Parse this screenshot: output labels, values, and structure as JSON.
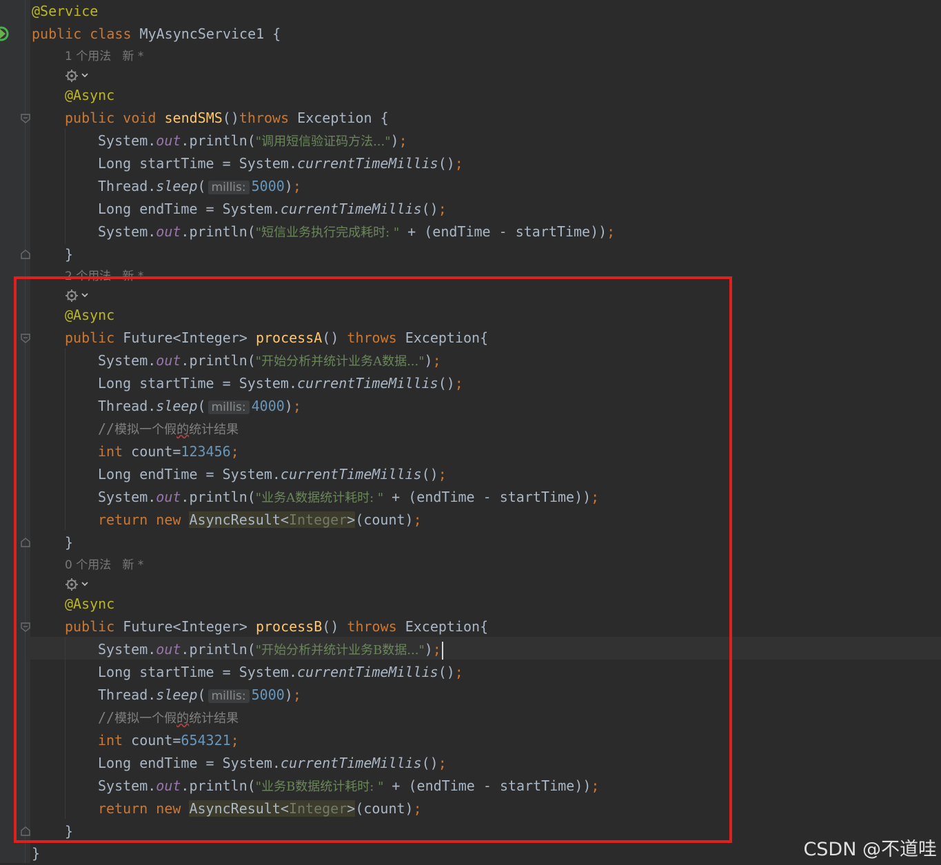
{
  "usage_hints": {
    "first": "1 个用法   新 *",
    "second": "2 个用法   新 *",
    "third": "0 个用法   新 *"
  },
  "icons": {
    "run_gutter": "run-gutter-icon",
    "inspect": "gear-chevron-icon",
    "fold": "fold-marker-icon"
  },
  "colors": {
    "background": "#2b2b2b",
    "keyword": "#cc7832",
    "annotation": "#bbb529",
    "method": "#ffc66d",
    "string": "#6a8759",
    "number": "#6897bb",
    "highlight_box": "#e0201e"
  },
  "code": {
    "l01_a": "@Service",
    "l02_kw": "public class",
    "l02_b": " MyAsyncService1 {",
    "l03_a": "@Async",
    "l04_kw1": "public void",
    "l04_fn": "sendSMS",
    "l04_p": "()",
    "l04_kw2": "throws",
    "l04_b": " Exception {",
    "l05_a": "System.",
    "l05_f": "out",
    "l05_b": ".println(",
    "l05_s": "\"调用短信验证码方法...\"",
    "l05_c": ")",
    "l05_sc": ";",
    "l06_a": "Long startTime = System.",
    "l06_i": "currentTimeMillis",
    "l06_b": "()",
    "l06_sc": ";",
    "l07_a": "Thread.",
    "l07_i": "sleep",
    "l07_b": "(",
    "l07_hint": "millis:",
    "l07_n": "5000",
    "l07_c": ")",
    "l07_sc": ";",
    "l08_a": "Long endTime = System.",
    "l08_i": "currentTimeMillis",
    "l08_b": "()",
    "l08_sc": ";",
    "l09_a": "System.",
    "l09_f": "out",
    "l09_b": ".println(",
    "l09_s": "\"短信业务执行完成耗时: \"",
    "l09_c": " + (endTime - startTime))",
    "l09_sc": ";",
    "l10_a": "}",
    "l11_a": "@Async",
    "l12_kw1": "public",
    "l12_b": " Future<Integer> ",
    "l12_fn": "processA",
    "l12_p": "() ",
    "l12_kw2": "throws",
    "l12_c": " Exception{",
    "l13_a": "System.",
    "l13_f": "out",
    "l13_b": ".println(",
    "l13_s": "\"开始分析并统计业务A数据...\"",
    "l13_c": ")",
    "l13_sc": ";",
    "l14_a": "Long startTime = System.",
    "l14_i": "currentTimeMillis",
    "l14_b": "()",
    "l14_sc": ";",
    "l15_a": "Thread.",
    "l15_i": "sleep",
    "l15_b": "(",
    "l15_hint": "millis:",
    "l15_n": "4000",
    "l15_c": ")",
    "l15_sc": ";",
    "l16_slash": "//",
    "l16_t1": "模拟一个假",
    "l16_t2": "的",
    "l16_t3": "统计结果",
    "l17_kw": "int",
    "l17_b": " count=",
    "l17_n": "123456",
    "l17_sc": ";",
    "l18_a": "Long endTime = System.",
    "l18_i": "currentTimeMillis",
    "l18_b": "()",
    "l18_sc": ";",
    "l19_a": "System.",
    "l19_f": "out",
    "l19_b": ".println(",
    "l19_s": "\"业务A数据统计耗时: \"",
    "l19_c": " + (endTime - startTime))",
    "l19_sc": ";",
    "l20_kw": "return new",
    "l20_sp": " ",
    "l20_cls": "AsyncResult<",
    "l20_gen": "Integer",
    "l20_gt": ">",
    "l20_b": "(count)",
    "l20_sc": ";",
    "l21_a": "}",
    "l22_a": "@Async",
    "l23_kw1": "public",
    "l23_b": " Future<Integer> ",
    "l23_fn": "processB",
    "l23_p": "() ",
    "l23_kw2": "throws",
    "l23_c": " Exception{",
    "l24_a": "System.",
    "l24_f": "out",
    "l24_b": ".println(",
    "l24_s": "\"开始分析并统计业务B数据...\"",
    "l24_c": ")",
    "l24_sc": ";",
    "l25_a": "Long startTime = System.",
    "l25_i": "currentTimeMillis",
    "l25_b": "()",
    "l25_sc": ";",
    "l26_a": "Thread.",
    "l26_i": "sleep",
    "l26_b": "(",
    "l26_hint": "millis:",
    "l26_n": "5000",
    "l26_c": ")",
    "l26_sc": ";",
    "l27_slash": "//",
    "l27_t1": "模拟一个假",
    "l27_t2": "的",
    "l27_t3": "统计结果",
    "l28_kw": "int",
    "l28_b": " count=",
    "l28_n": "654321",
    "l28_sc": ";",
    "l29_a": "Long endTime = System.",
    "l29_i": "currentTimeMillis",
    "l29_b": "()",
    "l29_sc": ";",
    "l30_a": "System.",
    "l30_f": "out",
    "l30_b": ".println(",
    "l30_s": "\"业务B数据统计耗时: \"",
    "l30_c": " + (endTime - startTime))",
    "l30_sc": ";",
    "l31_kw": "return new",
    "l31_sp": " ",
    "l31_cls": "AsyncResult<",
    "l31_gen": "Integer",
    "l31_gt": ">",
    "l31_b": "(count)",
    "l31_sc": ";",
    "l32_a": "}",
    "l33_a": "}"
  },
  "watermark": "CSDN @不道哇"
}
